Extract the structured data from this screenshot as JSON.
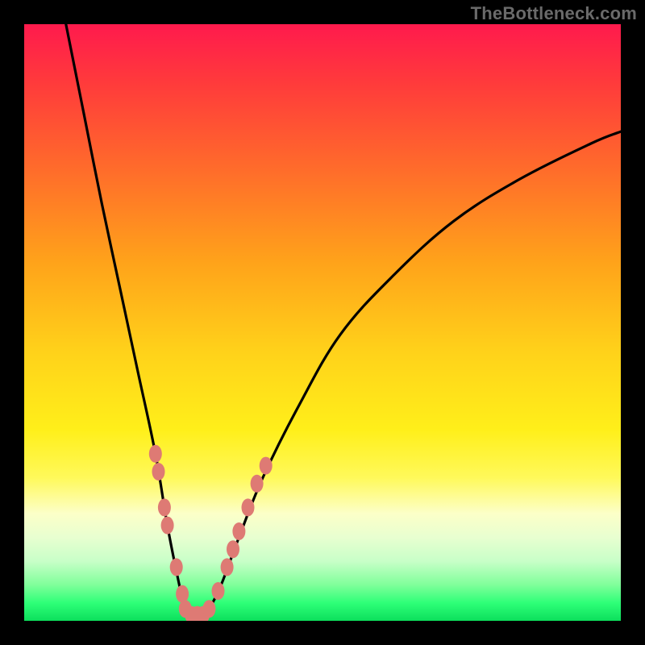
{
  "watermark": "TheBottleneck.com",
  "chart_data": {
    "type": "line",
    "title": "",
    "xlabel": "",
    "ylabel": "",
    "x_range": [
      0,
      100
    ],
    "y_range": [
      0,
      100
    ],
    "optimum_x": 28,
    "series": [
      {
        "name": "bottleneck-curve",
        "points": [
          {
            "x": 7,
            "y": 100
          },
          {
            "x": 10,
            "y": 85
          },
          {
            "x": 13,
            "y": 70
          },
          {
            "x": 16,
            "y": 56
          },
          {
            "x": 19,
            "y": 42
          },
          {
            "x": 22,
            "y": 28
          },
          {
            "x": 24,
            "y": 16
          },
          {
            "x": 26,
            "y": 6
          },
          {
            "x": 27,
            "y": 2
          },
          {
            "x": 28,
            "y": 1
          },
          {
            "x": 30,
            "y": 1
          },
          {
            "x": 31,
            "y": 2
          },
          {
            "x": 33,
            "y": 6
          },
          {
            "x": 36,
            "y": 14
          },
          {
            "x": 40,
            "y": 24
          },
          {
            "x": 46,
            "y": 36
          },
          {
            "x": 53,
            "y": 48
          },
          {
            "x": 62,
            "y": 58
          },
          {
            "x": 72,
            "y": 67
          },
          {
            "x": 83,
            "y": 74
          },
          {
            "x": 95,
            "y": 80
          },
          {
            "x": 100,
            "y": 82
          }
        ]
      }
    ],
    "markers": {
      "name": "marker-dots",
      "color": "#de7a74",
      "points": [
        {
          "x": 22,
          "y": 28
        },
        {
          "x": 22.5,
          "y": 25
        },
        {
          "x": 23.5,
          "y": 19
        },
        {
          "x": 24,
          "y": 16
        },
        {
          "x": 25.5,
          "y": 9
        },
        {
          "x": 26.5,
          "y": 4.5
        },
        {
          "x": 27,
          "y": 2
        },
        {
          "x": 28,
          "y": 1
        },
        {
          "x": 29,
          "y": 1
        },
        {
          "x": 30,
          "y": 1
        },
        {
          "x": 31,
          "y": 2
        },
        {
          "x": 32.5,
          "y": 5
        },
        {
          "x": 34,
          "y": 9
        },
        {
          "x": 35,
          "y": 12
        },
        {
          "x": 36,
          "y": 15
        },
        {
          "x": 37.5,
          "y": 19
        },
        {
          "x": 39,
          "y": 23
        },
        {
          "x": 40.5,
          "y": 26
        }
      ]
    }
  }
}
